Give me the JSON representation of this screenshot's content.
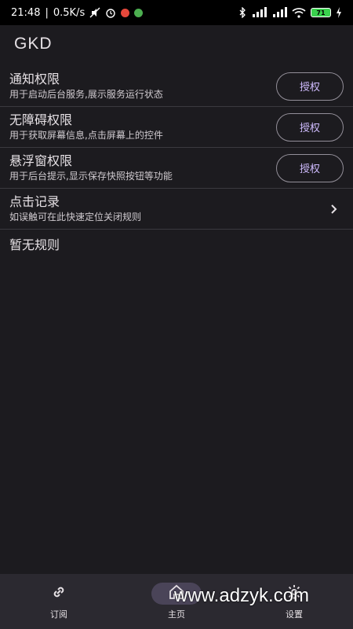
{
  "status_bar": {
    "time": "21:48",
    "speed": "0.5K/s",
    "battery_level": "71",
    "icons": [
      "bluetooth-icon",
      "signal-hd-icon",
      "signal-hd-icon",
      "wifi-icon",
      "battery-icon",
      "charging-icon"
    ]
  },
  "app_bar": {
    "title": "GKD"
  },
  "permissions": [
    {
      "title": "通知权限",
      "subtitle": "用于启动后台服务,展示服务运行状态",
      "button": "授权"
    },
    {
      "title": "无障碍权限",
      "subtitle": "用于获取屏幕信息,点击屏幕上的控件",
      "button": "授权"
    },
    {
      "title": "悬浮窗权限",
      "subtitle": "用于后台提示,显示保存快照按钮等功能",
      "button": "授权"
    }
  ],
  "click_log": {
    "title": "点击记录",
    "subtitle": "如误触可在此快速定位关闭规则"
  },
  "empty_rules_text": "暂无规则",
  "bottom_nav": {
    "items": [
      {
        "label": "订阅",
        "icon": "link-icon"
      },
      {
        "label": "主页",
        "icon": "home-icon"
      },
      {
        "label": "设置",
        "icon": "gear-icon"
      }
    ],
    "active": "主页"
  },
  "watermark": "www.adzyk.com",
  "colors": {
    "background": "#1c1b1f",
    "accent": "#d0bcff",
    "nav_background": "#2b2930",
    "active_indicator": "#4a4458"
  }
}
